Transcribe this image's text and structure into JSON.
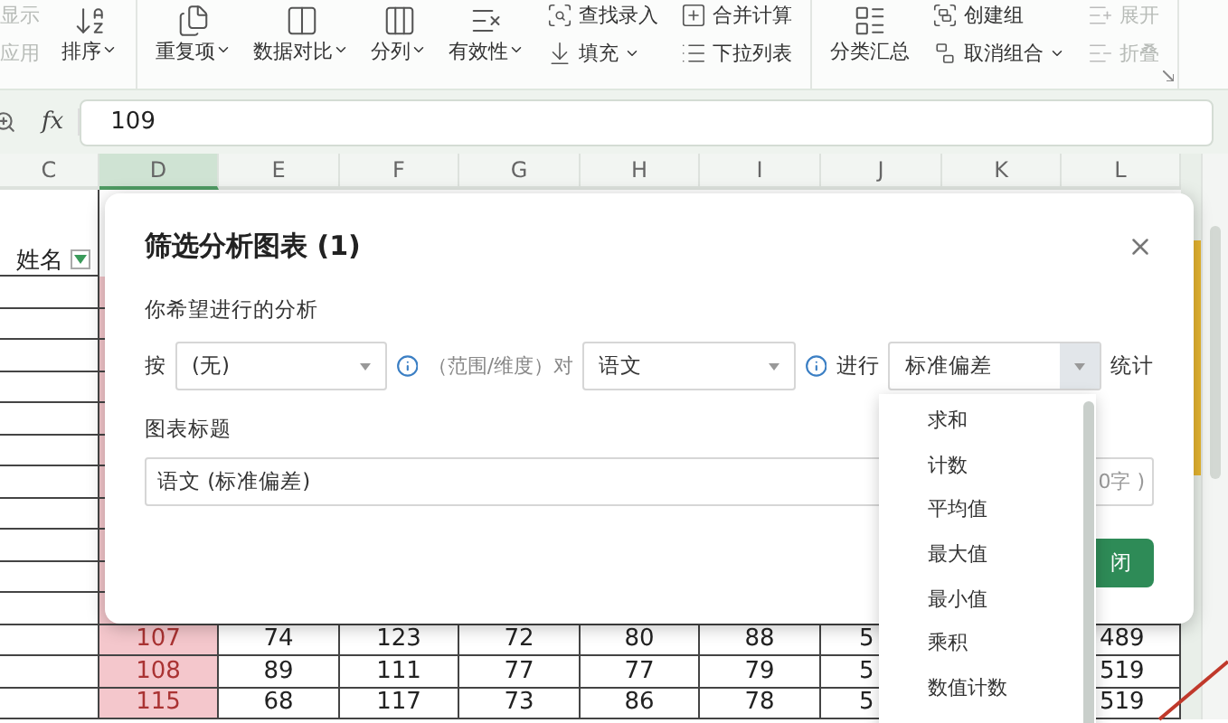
{
  "ribbon": {
    "groups": [
      {
        "items": [
          {
            "kind": "stack",
            "buttons": [
              {
                "label": "显示",
                "disabled": true,
                "menu": false
              },
              {
                "label": "应用",
                "disabled": true,
                "menu": false
              }
            ]
          },
          {
            "kind": "large",
            "label": "排序",
            "menu": true,
            "disabled": false
          }
        ]
      },
      {
        "items": [
          {
            "kind": "large",
            "label": "重复项",
            "menu": true,
            "disabled": false
          },
          {
            "kind": "large",
            "label": "数据对比",
            "menu": true,
            "disabled": false
          },
          {
            "kind": "large",
            "label": "分列",
            "menu": true,
            "disabled": false
          },
          {
            "kind": "large",
            "label": "有效性",
            "menu": true,
            "disabled": false
          },
          {
            "kind": "stack",
            "buttons": [
              {
                "label": "查找录入",
                "disabled": false,
                "menu": false
              },
              {
                "label": "填充",
                "disabled": false,
                "menu": true
              }
            ]
          },
          {
            "kind": "stack",
            "buttons": [
              {
                "label": "合并计算",
                "disabled": false,
                "menu": false
              },
              {
                "label": "下拉列表",
                "disabled": false,
                "menu": false
              }
            ]
          }
        ]
      },
      {
        "items": [
          {
            "kind": "large",
            "label": "分类汇总",
            "menu": false,
            "disabled": false
          },
          {
            "kind": "stack",
            "buttons": [
              {
                "label": "创建组",
                "disabled": false,
                "menu": false
              },
              {
                "label": "取消组合",
                "disabled": false,
                "menu": true
              }
            ]
          },
          {
            "kind": "stack",
            "buttons": [
              {
                "label": "展开",
                "disabled": true,
                "menu": false
              },
              {
                "label": "折叠",
                "disabled": true,
                "menu": false
              }
            ]
          }
        ]
      }
    ]
  },
  "formula_bar": {
    "fx_label": "fx",
    "value": "109"
  },
  "sheet": {
    "columns": [
      {
        "label": "C",
        "selected": false,
        "highlighted": false
      },
      {
        "label": "D",
        "selected": true,
        "highlighted": true
      },
      {
        "label": "E",
        "selected": false,
        "highlighted": false
      },
      {
        "label": "F",
        "selected": false,
        "highlighted": false
      },
      {
        "label": "G",
        "selected": false,
        "highlighted": false
      },
      {
        "label": "H",
        "selected": false,
        "highlighted": false
      },
      {
        "label": "I",
        "selected": false,
        "highlighted": false
      },
      {
        "label": "J",
        "selected": false,
        "highlighted": false
      },
      {
        "label": "K",
        "selected": false,
        "highlighted": false
      },
      {
        "label": "L",
        "selected": false,
        "highlighted": false
      }
    ],
    "header_cell": {
      "text": "姓名",
      "filter": true
    },
    "edge_column": {
      "highlighted": true
    },
    "rows": [
      {
        "cells": [
          "",
          "107",
          "74",
          "123",
          "72",
          "80",
          "88",
          "5",
          "",
          "489"
        ]
      },
      {
        "cells": [
          "",
          "108",
          "89",
          "111",
          "77",
          "77",
          "79",
          "5",
          "",
          "519"
        ]
      },
      {
        "cells": [
          "",
          "115",
          "68",
          "117",
          "73",
          "86",
          "78",
          "5",
          "",
          "519"
        ]
      }
    ]
  },
  "dialog": {
    "title": "筛选分析图表 (1)",
    "prompt": "你希望进行的分析",
    "by_label": "按",
    "group_select": "(无)",
    "range_hint": "（范围/维度）对",
    "field_select": "语文",
    "do_label": "进行",
    "stat_select": "标准偏差",
    "stat_label": "统计",
    "title_label": "图表标题",
    "title_value": "语文 (标准偏差)",
    "counter": "0字 )",
    "close_button": "闭"
  },
  "dropdown": {
    "options": [
      {
        "label": "求和",
        "selected": false
      },
      {
        "label": "计数",
        "selected": false
      },
      {
        "label": "平均值",
        "selected": false
      },
      {
        "label": "最大值",
        "selected": false
      },
      {
        "label": "最小值",
        "selected": false
      },
      {
        "label": "乘积",
        "selected": false
      },
      {
        "label": "数值计数",
        "selected": false
      }
    ]
  }
}
